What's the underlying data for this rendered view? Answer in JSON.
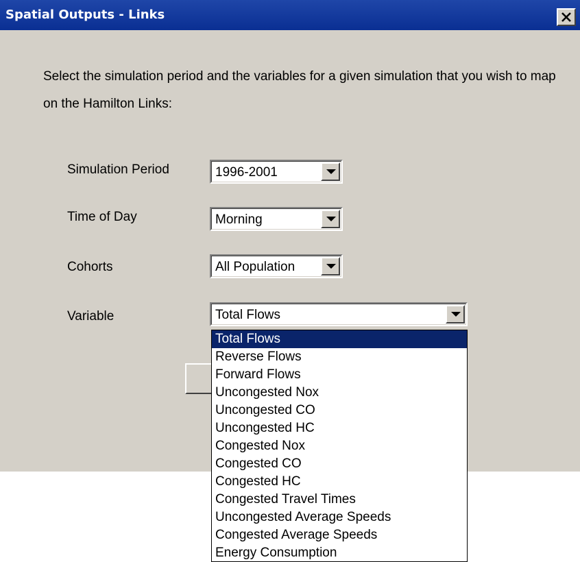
{
  "window": {
    "title": "Spatial Outputs - Links",
    "close_label": "X"
  },
  "instructions": "Select the simulation period and the variables for a given simulation that you wish to map on the Hamilton Links:",
  "fields": {
    "simulation_period": {
      "label": "Simulation Period",
      "value": "1996-2001"
    },
    "time_of_day": {
      "label": "Time of Day",
      "value": "Morning"
    },
    "cohorts": {
      "label": "Cohorts",
      "value": "All Population"
    },
    "variable": {
      "label": "Variable",
      "value": "Total Flows"
    }
  },
  "variable_options": [
    "Total Flows",
    "Reverse Flows",
    "Forward Flows",
    "Uncongested Nox",
    "Uncongested CO",
    "Uncongested HC",
    "Congested Nox",
    "Congested CO",
    "Congested HC",
    "Congested Travel Times",
    "Uncongested Average Speeds",
    "Congested Average Speeds",
    "Energy Consumption"
  ],
  "selected_option_index": 0,
  "icons": {
    "close": "close-icon",
    "dropdown": "chevron-down-icon"
  },
  "colors": {
    "titlebar": "#0a2f93",
    "dialog_background": "#d4d0c8",
    "selection": "#0a246a"
  }
}
